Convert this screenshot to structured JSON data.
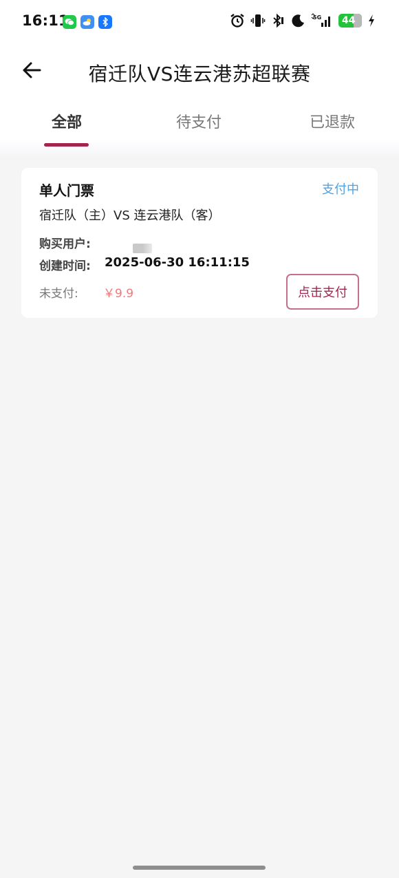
{
  "status_bar": {
    "time": "16:11",
    "battery_level": "44",
    "colors": {
      "wechat": "#20c94a",
      "weather": "#3f8ff5",
      "battery": "#22c33b"
    }
  },
  "header": {
    "title": "宿迁队VS连云港苏超联赛"
  },
  "tabs": {
    "items": [
      {
        "label": "全部",
        "active": true
      },
      {
        "label": "待支付",
        "active": false
      },
      {
        "label": "已退款",
        "active": false
      }
    ],
    "indicator_color": "#a3244c"
  },
  "order": {
    "ticket_type": "单人门票",
    "status": "支付中",
    "match": "宿迁队（主）VS 连云港队（客）",
    "buyer_label": "购买用户:",
    "created_label": "创建时间:",
    "created_value": "2025-06-30 16:11:15",
    "unpaid_label": "未支付:",
    "amount": "￥9.9",
    "pay_button_label": "点击支付",
    "colors": {
      "status": "#4fa3e3",
      "amount": "#f07a7a",
      "button": "#a3244c"
    }
  }
}
